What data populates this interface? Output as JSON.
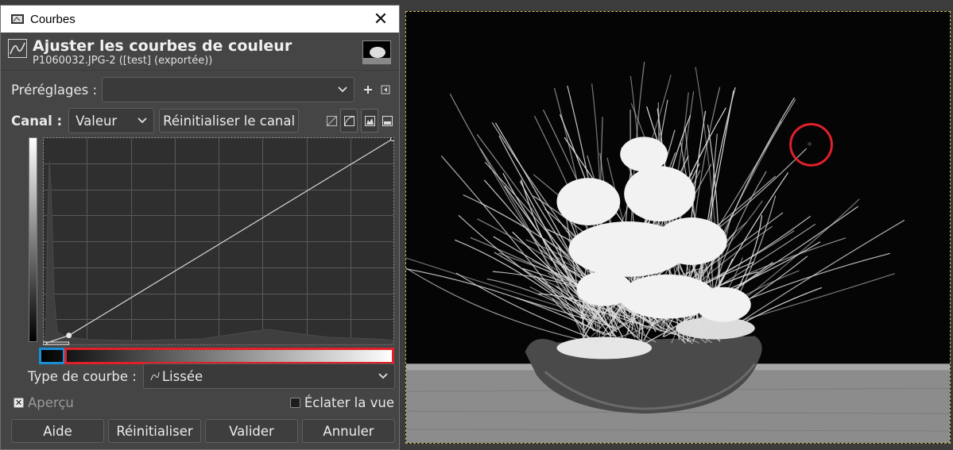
{
  "window": {
    "title": "Courbes",
    "close_glyph": "✕"
  },
  "header": {
    "title": "Ajuster les courbes de couleur",
    "subtitle": "P1060032.JPG-2 ([test] (exportée))"
  },
  "presets": {
    "label": "Préréglages :",
    "value": ""
  },
  "channel": {
    "label": "Canal :",
    "value": "Valeur",
    "reset_label": "Réinitialiser le canal"
  },
  "curve_type": {
    "label": "Type de courbe :",
    "value": "Lissée"
  },
  "preview": {
    "label": "Aperçu",
    "checked": true
  },
  "split_view": {
    "label": "Éclater la vue",
    "checked": false
  },
  "buttons": {
    "help": "Aide",
    "reset": "Réinitialiser",
    "ok": "Valider",
    "cancel": "Annuler"
  },
  "curve": {
    "points": [
      [
        0,
        0
      ],
      [
        0.07,
        0.04
      ],
      [
        1,
        1
      ]
    ],
    "input_range_low": 0.07
  },
  "colors": {
    "annotation_red": "#e0202a",
    "annotation_blue": "#1a8fd6",
    "selection_border": "#c9b650"
  },
  "icons": [
    "curve-icon",
    "plus-icon",
    "menu-icon",
    "chevron-down-icon",
    "close-icon",
    "linear-mode-icon",
    "log-mode-icon",
    "histogram-icon"
  ]
}
